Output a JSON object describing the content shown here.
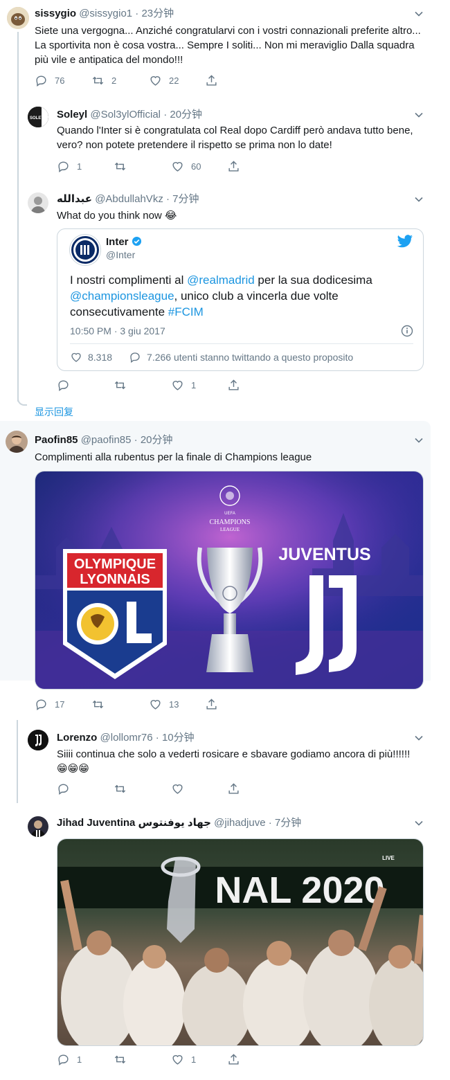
{
  "tweets": [
    {
      "name": "sissygio",
      "handle": "@sissygio1",
      "time": "23分钟",
      "text": "Siete una vergogna... Anziché congratularvi con i vostri connazionali preferite altro... La sportivita non è cosa vostra... Sempre I soliti... Non mi meraviglio Dalla squadra più vile e antipatica del mondo!!!",
      "replies": "76",
      "retweets": "2",
      "likes": "22"
    },
    {
      "name": "Soleyl",
      "handle": "@Sol3ylOfficial",
      "time": "20分钟",
      "text": "Quando l'Inter si è congratulata col Real dopo Cardiff però andava tutto bene, vero? non potete pretendere il rispetto se prima non lo date!",
      "replies": "1",
      "retweets": "",
      "likes": "60",
      "avatar_text": "SOLEYL"
    },
    {
      "name": "عبدالله",
      "handle": "@AbdullahVkz",
      "time": "7分钟",
      "text": "What do you think now 😂",
      "replies": "",
      "retweets": "",
      "likes": "1"
    },
    {
      "name": "Paofin85",
      "handle": "@paofin85",
      "time": "20分钟",
      "text": "Complimenti alla rubentus per la finale di Champions league",
      "replies": "17",
      "retweets": "",
      "likes": "13"
    },
    {
      "name": "Lorenzo",
      "handle": "@lollomr76",
      "time": "10分钟",
      "text": "Siiii continua che solo a vederti rosicare e sbavare godiamo ancora di più!!!!!! 😁😁😁",
      "replies": "",
      "retweets": "",
      "likes": ""
    },
    {
      "name": "Jihad Juventina جهاد يوفنتوس",
      "handle": "@jihadjuve",
      "time": "7分钟",
      "text": "",
      "replies": "1",
      "retweets": "",
      "likes": "1"
    }
  ],
  "quote": {
    "name": "Inter",
    "handle": "@Inter",
    "text_a": "I nostri complimenti al ",
    "mention1": "@realmadrid",
    "text_b": " per la sua dodicesima ",
    "mention2": "@championsleague",
    "text_c": ", unico club a vincerla due volte consecutivamente ",
    "hashtag": "#FCIM",
    "time": "10:50 PM · 3 giu 2017",
    "likes": "8.318",
    "talking": "7.266 utenti stanno twittando a questo proposito"
  },
  "show_replies": "显示回复",
  "ucl_image": {
    "left_club": "OLYMPIQUE\nLYONNAIS",
    "left_line1": "OLYMPIQUE",
    "left_line2": "LYONNAIS",
    "right_club": "JUVENTUS",
    "center_line1": "CHAMPIONS",
    "center_line2": "LEAGUE",
    "uefa": "UEFA"
  },
  "celebration_image": {
    "banner": "NAL 2020",
    "badge": "LIVE"
  },
  "colors": {
    "accent": "#1b95e0",
    "text_secondary": "#657786",
    "border": "#ccd6dd",
    "highlight_bg": "#f5f8fa"
  }
}
